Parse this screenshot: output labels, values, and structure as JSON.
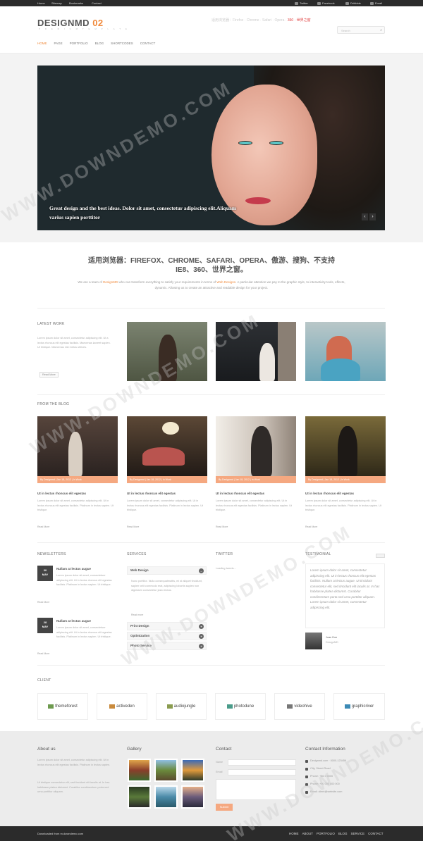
{
  "topbar": {
    "links": [
      "Home",
      "Sitemap",
      "Bookmarks",
      "Contact"
    ],
    "social": [
      "Twitter",
      "Facebook",
      "Dribbble",
      "Email"
    ]
  },
  "header": {
    "logo_main": "DESIGNMD",
    "logo_num": "02",
    "logo_sub": "P R E M I U M   T E M P L A T E",
    "browser_note": "适用浏览器：Firefox · Chrome · Safari · Opera ·",
    "browser_note_red": "360 · 世界之窗",
    "search_placeholder": "Search",
    "nav": [
      "HOME",
      "PAGE",
      "PORTFOLIO",
      "BLOG",
      "SHORTCODES",
      "CONTACT"
    ]
  },
  "slider": {
    "caption": "Great design and the best ideas. Dolor sit amet, consectetur adipiscing elit.Aliquam varius sapien porttitor",
    "prev": "‹",
    "next": "›"
  },
  "intro": {
    "title": "适用浏览器：FIREFOX、CHROME、SAFARI、OPERA、傲游、搜狗、不支持IE8、360、世界之窗。",
    "text_pre": "We are a team of ",
    "text_hl1": "DesignMD",
    "text_mid": " who can transform everything to satisfy your requirements in terms of ",
    "text_hl2": "Web Designs",
    "text_post": ". A particular attention we pay to the graphic style, to interactivity tools, effects, dynamic. Allowing us to create an attractive and readable design for your project."
  },
  "latest_work": {
    "title": "LATEST WORK",
    "text": "Lorem ipsum dolor sit amet, consectetur adipiscing elit. Ut a lectus rhoncus elit egestas facilisis. Maecenas laoreet sapien. Ut tristique. Maecenas nisl metus ultrices.",
    "button": "Read More"
  },
  "blog": {
    "title": "FROM THE BLOG",
    "posts": [
      {
        "meta": "By Designmd | Jan 18, 2012 | In Work",
        "title": "Ut in lectus rhoncus elit egestas",
        "text": "Lorem ipsum dolor sit amet, consectetur adipiscing elit. Ut in lectus rhoncus elit egestas facilisis. Platinum in lectus sapien. Ut tristique.",
        "more": "Read More"
      },
      {
        "meta": "By Designmd | Jan 18, 2012 | In Work",
        "title": "Ut in lectus rhoncus elit egestas",
        "text": "Lorem ipsum dolor sit amet, consectetur adipiscing elit. Ut in lectus rhoncus elit egestas facilisis. Platinum in lectus sapien. Ut tristique.",
        "more": "Read More"
      },
      {
        "meta": "By Designmd | Jan 18, 2012 | In Work",
        "title": "Ut in lectus rhoncus elit egestas",
        "text": "Lorem ipsum dolor sit amet, consectetur adipiscing elit. Ut in lectus rhoncus elit egestas facilisis. Platinum in lectus sapien. Ut tristique.",
        "more": "Read More"
      },
      {
        "meta": "By Designmd | Jan 18, 2012 | In Work",
        "title": "Ut in lectus rhoncus elit egestas",
        "text": "Lorem ipsum dolor sit amet, consectetur adipiscing elit. Ut in lectus rhoncus elit egestas facilisis. Platinum in lectus sapien. Ut tristique.",
        "more": "Read More"
      }
    ]
  },
  "newsletters": {
    "title": "NEWSLETTERS",
    "items": [
      {
        "day": "30",
        "month": "MAY",
        "title": "Nullam at lectus augue",
        "text": "Lorem ipsum dolor sit amet, consectetuer adipiscing elit. Ut in lectus rhoncus elit egestas facilisis. Platinum in lectus sapien. Ut tristique.",
        "more": "Read More"
      },
      {
        "day": "28",
        "month": "MAY",
        "title": "Nullam at lectus augue",
        "text": "Lorem ipsum dolor sit amet, consectetuer adipiscing elit. Ut in lectus rhoncus elit egestas facilisis. Platinum in lectus sapien. Ut tristique.",
        "more": "Read More"
      }
    ]
  },
  "services": {
    "title": "SERVICES",
    "first": "Web Design",
    "first_text": "Nunc porttitor. Nulla consequatmattis, mi at aliquet tincidunt, sapien velit commodo erat, adipiscing lobortis sapien non dignissim consectetur justo lectus.",
    "first_more": "Read more",
    "items": [
      "Print Design",
      "Optimization",
      "Photo Service"
    ]
  },
  "twitter": {
    "title": "TWITTER",
    "text": "Loading tweets..."
  },
  "testimonial": {
    "title": "TESTIMONIAL",
    "quote": "Lorem ipsum dolor sit amet, consectetur adipiscing elit. Ut in lectus rhoncus elit egestas facilisis. Nullam at lectus augue. Ut tincidunt consectetur elit, sed tincidunt elit iaculis at. In hac habitasse platea dictumst. Curabitur condimentum porta sed urna porttitor aliquam. Lorem ipsum dolor sit amet, consectetur adipiscing elit.",
    "name": "Joan Doe",
    "role": "DesignMD"
  },
  "clients": {
    "title": "CLIENT",
    "items": [
      "themeforest",
      "activeden",
      "audiojungle",
      "photodune",
      "videohive",
      "graphicriver"
    ]
  },
  "footer": {
    "about_title": "About us",
    "about_text1": "Lorem ipsum dolor sit amet, consectetur adipiscing elit. Ut in lectus rhoncus elit egestas facilisis. Platinum in lectus sapien.",
    "about_text2": "Ut tristique consectetur elit, sed tincidunt elit iaculis at. In hac habitasse platea dictumst. Curabitur condimentum porta sed urna porttitor aliquam.",
    "gallery_title": "Gallery",
    "contact_title": "Contact",
    "name_label": "Name",
    "email_label": "Email",
    "submit": "Submit",
    "info_title": "Contact Information",
    "info": [
      "Designmd.com · 0000-123456",
      "City, Street Road",
      "Phone: +86 0 0000",
      "Phone: +00 000 000 000",
      "Email: client@website.com"
    ]
  },
  "bottom": {
    "copyright": "Downloaded from m.downdemo.com",
    "nav": [
      "HOME",
      "ABOUT",
      "PORTFOLIO",
      "BLOG",
      "SERVICE",
      "CONTACT"
    ]
  },
  "watermark": "WWW.DOWNDEMO.COM"
}
